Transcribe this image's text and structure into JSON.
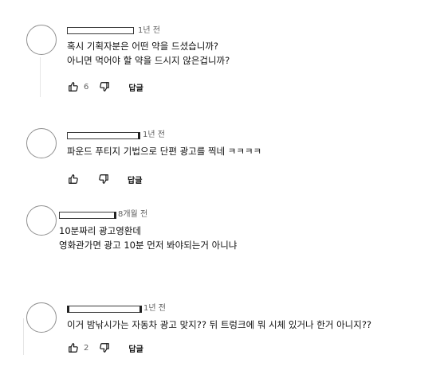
{
  "comments": [
    {
      "time": "1년 전",
      "lines": [
        "혹시 기획자분은 어떤 약을 드셨습니까?",
        "아니면 먹어야 할 약을 드시지 않은겁니까?"
      ],
      "likes": "6",
      "reply": "답글"
    },
    {
      "time": "1년 전",
      "lines": [
        "파운드 푸티지 기법으로 단편 광고를 찍네 ㅋㅋㅋㅋ"
      ],
      "likes": "",
      "reply": "답글"
    },
    {
      "time": "8개월 전",
      "lines": [
        "10분짜리 광고영환데",
        "영화관가면 광고 10분 먼저 봐야되는거 아니냐"
      ]
    },
    {
      "time": "1년 전",
      "lines": [
        "이거 밤낚시가는 자동차 광고 맞지?? 뒤 트렁크에 뭐 시체 있거나 한거 아니지??"
      ],
      "likes": "2",
      "reply": "답글"
    }
  ],
  "icons": {
    "like": "thumbs-up-icon",
    "dislike": "thumbs-down-icon"
  },
  "colors": {
    "avatar_border": "#909090",
    "meta_text": "#606060"
  }
}
